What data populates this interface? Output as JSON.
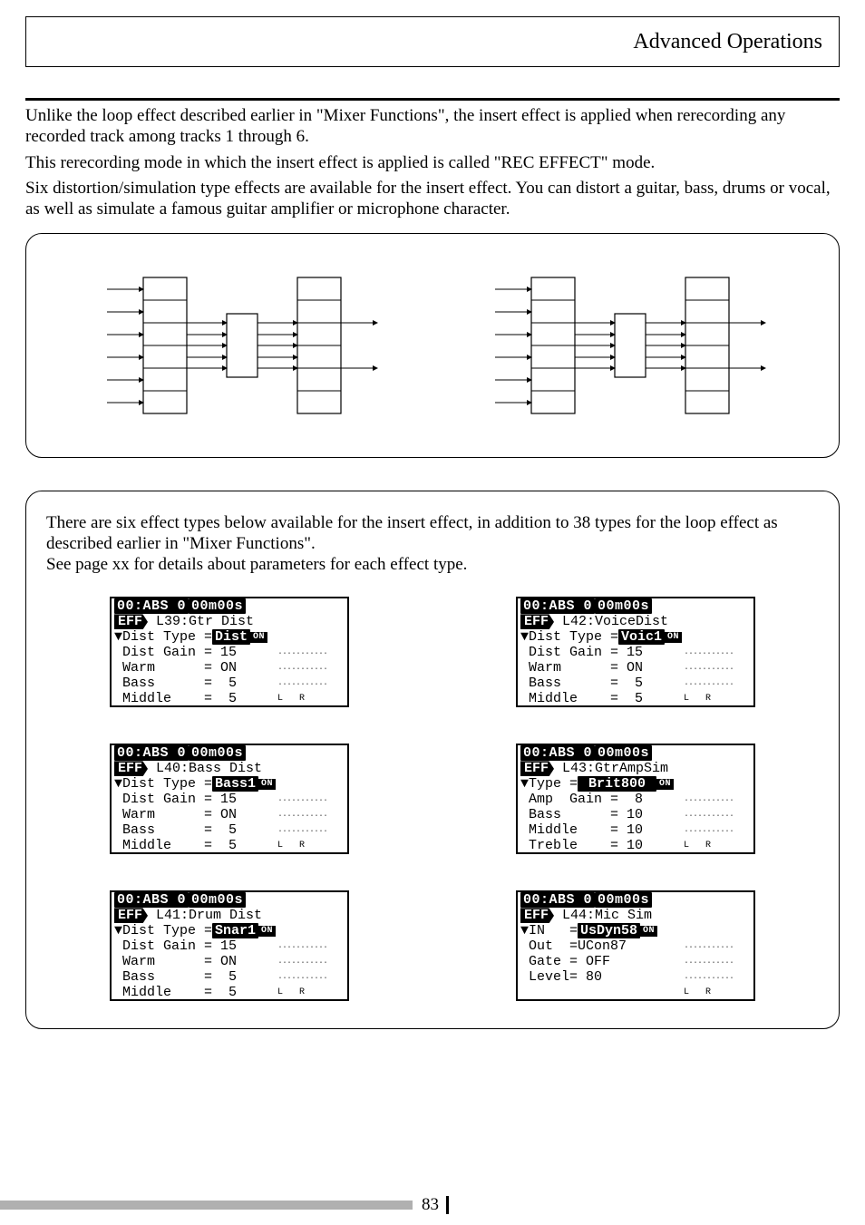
{
  "header": {
    "title": "Advanced Operations"
  },
  "paragraphs": {
    "p1": "Unlike the loop effect described earlier in \"Mixer Functions\", the insert effect is applied when rerecording any recorded track among tracks 1 through 6.",
    "p2": "This rerecording mode in which the insert effect is applied is called \"REC EFFECT\" mode.",
    "p3": "Six distortion/simulation type effects are available for the insert effect. You can distort a guitar, bass, drums or vocal, as well as simulate a famous guitar amplifier or microphone character."
  },
  "effects_intro": {
    "line1": "There are six effect types below available for the insert effect, in addition to 38 types for the loop effect as described earlier in \"Mixer Functions\".",
    "line2": "See page xx for details about parameters for each effect type."
  },
  "lcd_common": {
    "abs": "00:ABS 0",
    "time_badge": "00m00s",
    "eff_tag": "EFF",
    "on_badge": "ON",
    "lr": "L  R",
    "dots": "..........."
  },
  "lcds": {
    "l39": {
      "title": "L39:Gtr Dist",
      "type_label": "▼Dist Type =",
      "type_value": "Dist",
      "rows": [
        "Dist Gain = 15",
        "Warm      = ON",
        "Bass      =  5",
        "Middle    =  5"
      ]
    },
    "l40": {
      "title": "L40:Bass Dist",
      "type_label": "▼Dist Type =",
      "type_value": "Bass1",
      "rows": [
        "Dist Gain = 15",
        "Warm      = ON",
        "Bass      =  5",
        "Middle    =  5"
      ]
    },
    "l41": {
      "title": "L41:Drum Dist",
      "type_label": "▼Dist Type =",
      "type_value": "Snar1",
      "rows": [
        "Dist Gain = 15",
        "Warm      = ON",
        "Bass      =  5",
        "Middle    =  5"
      ]
    },
    "l42": {
      "title": "L42:VoiceDist",
      "type_label": "▼Dist Type =",
      "type_value": "Voic1",
      "rows": [
        "Dist Gain = 15",
        "Warm      = ON",
        "Bass      =  5",
        "Middle    =  5"
      ]
    },
    "l43": {
      "title": "L43:GtrAmpSim",
      "type_label": "▼Type =",
      "type_value": " Brit800 ",
      "rows": [
        "Amp  Gain =  8",
        "Bass      = 10",
        "Middle    = 10",
        "Treble    = 10"
      ]
    },
    "l44": {
      "title": "L44:Mic Sim",
      "type_label": "▼IN   =",
      "type_value": "UsDyn58",
      "rows": [
        "Out  =UCon87",
        "Gate = OFF",
        "Level= 80",
        " "
      ]
    }
  },
  "page_number": "83"
}
